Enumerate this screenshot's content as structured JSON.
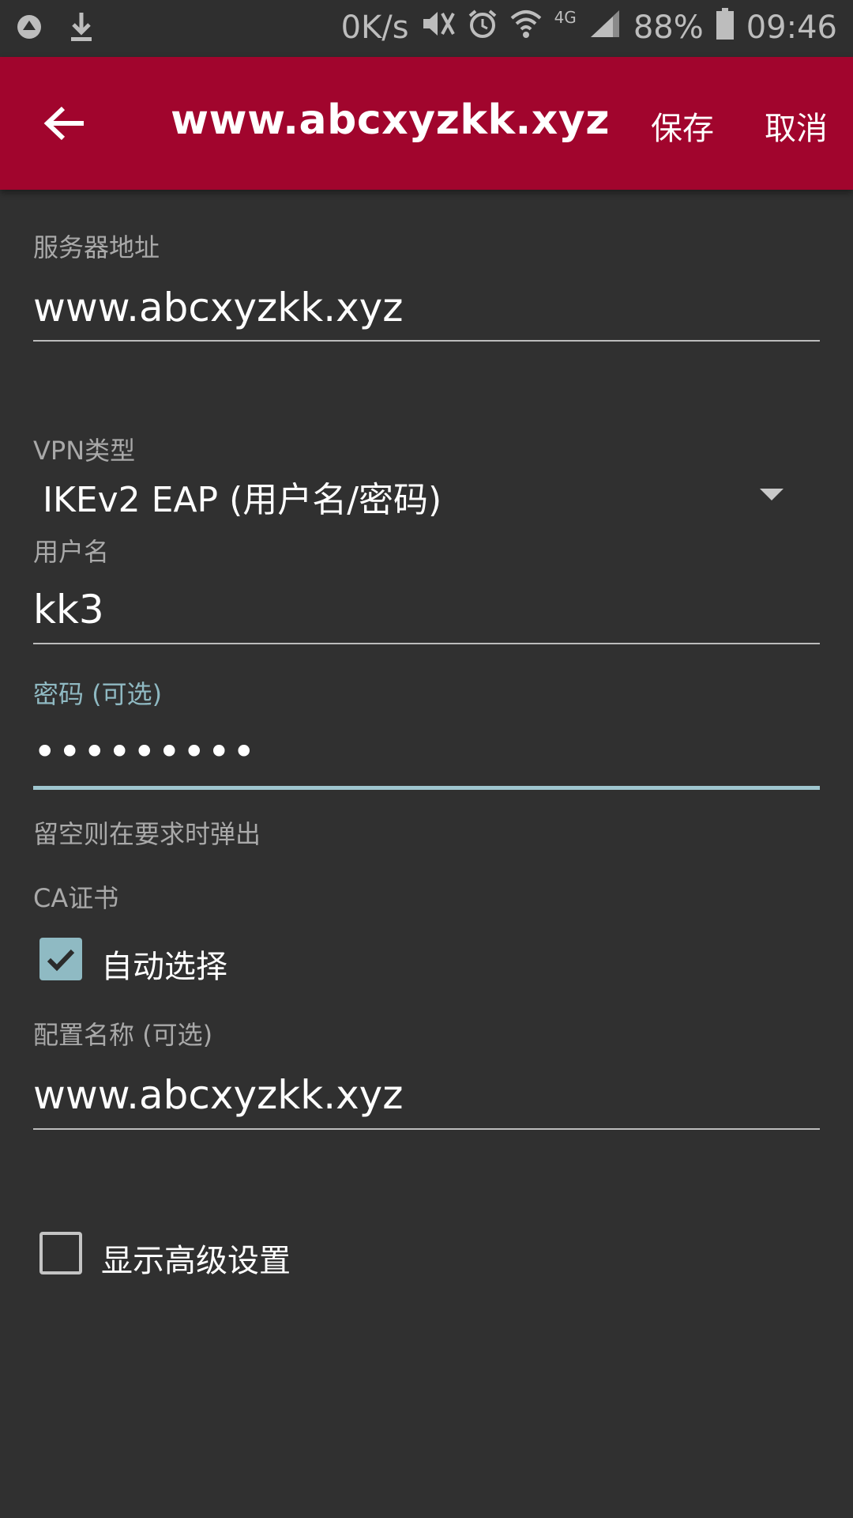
{
  "status_bar": {
    "net_speed": "0K/s",
    "network_type": "4G",
    "battery": "88%",
    "time": "09:46",
    "icons": [
      "app-icon",
      "download-icon",
      "mute-icon",
      "alarm-icon",
      "wifi-icon",
      "signal-icon",
      "battery-icon"
    ]
  },
  "toolbar": {
    "title": "www.abcxyzkk.xyz",
    "save_label": "保存",
    "cancel_label": "取消",
    "accent_color": "#a1052d"
  },
  "form": {
    "server": {
      "label": "服务器地址",
      "value": "www.abcxyzkk.xyz"
    },
    "vpn_type": {
      "label": "VPN类型",
      "value": "IKEv2 EAP (用户名/密码)"
    },
    "username": {
      "label": "用户名",
      "value": "kk3"
    },
    "password": {
      "label": "密码 (可选)",
      "value": "•••••••••",
      "hint": "留空则在要求时弹出"
    },
    "ca_cert": {
      "label": "CA证书",
      "auto_select_label": "自动选择",
      "auto_select_checked": true
    },
    "profile_name": {
      "label": "配置名称 (可选)",
      "value": "www.abcxyzkk.xyz"
    },
    "advanced": {
      "label": "显示高级设置",
      "checked": false
    }
  }
}
